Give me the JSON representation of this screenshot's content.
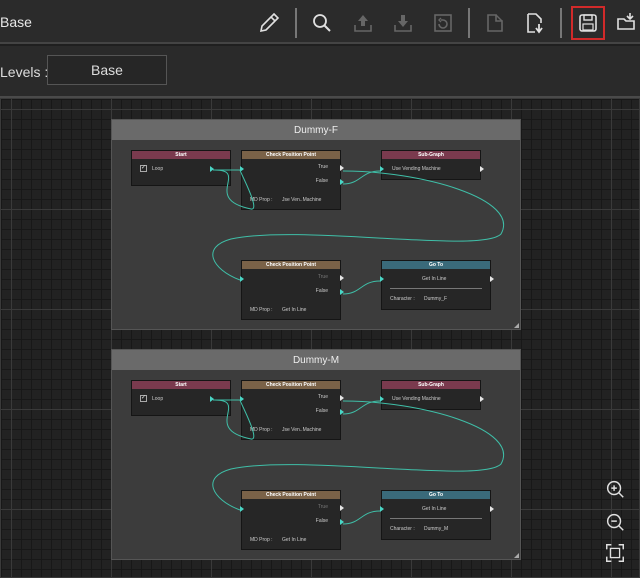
{
  "window": {
    "title": "Base"
  },
  "toolbar": {
    "buttons": [
      {
        "name": "eyedropper-icon",
        "state": "enabled"
      },
      {
        "name": "search-icon",
        "state": "enabled"
      },
      {
        "name": "export-up-icon",
        "state": "disabled"
      },
      {
        "name": "import-down-icon",
        "state": "disabled"
      },
      {
        "name": "refresh-icon",
        "state": "disabled"
      },
      {
        "name": "paste-doc-icon",
        "state": "disabled"
      },
      {
        "name": "document-download-icon",
        "state": "enabled"
      },
      {
        "name": "save-icon",
        "state": "selected"
      },
      {
        "name": "folder-open-icon",
        "state": "enabled"
      }
    ]
  },
  "levels": {
    "label": "Levels :",
    "value": "Base"
  },
  "groups": [
    {
      "title": "Dummy-F",
      "start": {
        "header": "Start",
        "loop_label": "Loop",
        "loop_checked": true
      },
      "check1": {
        "header": "Check Position Point",
        "true_label": "True",
        "false_label": "False",
        "prop_label": "MD Prop :",
        "prop_value": "Jse Ven..Machine"
      },
      "subgraph": {
        "header": "Sub-Graph",
        "value": "Use Vending Machine"
      },
      "check2": {
        "header": "Check Position Point",
        "true_label": "True",
        "false_label": "False",
        "prop_label": "MD Prop :",
        "prop_value": "Get In Line"
      },
      "goto": {
        "header": "Go To",
        "value": "Get In Line",
        "char_label": "Character :",
        "char_value": "Dummy_F"
      }
    },
    {
      "title": "Dummy-M",
      "start": {
        "header": "Start",
        "loop_label": "Loop",
        "loop_checked": true
      },
      "check1": {
        "header": "Check Position Point",
        "true_label": "True",
        "false_label": "False",
        "prop_label": "MD Prop :",
        "prop_value": "Jse Ven..Machine"
      },
      "subgraph": {
        "header": "Sub-Graph",
        "value": "Use Vending Machine"
      },
      "check2": {
        "header": "Check Position Point",
        "true_label": "True",
        "false_label": "False",
        "prop_label": "MD Prop :",
        "prop_value": "Get In Line"
      },
      "goto": {
        "header": "Go To",
        "value": "Get In Line",
        "char_label": "Character :",
        "char_value": "Dummy_M"
      }
    }
  ],
  "zoom_controls": [
    {
      "name": "zoom-in-icon"
    },
    {
      "name": "zoom-out-icon"
    },
    {
      "name": "fit-view-icon"
    }
  ],
  "colors": {
    "accent_wire": "#4ad6c6",
    "selected_outline": "#d12a2a",
    "start_header": "#7a3a4e",
    "check_header": "#7a6248",
    "goto_header": "#3a6a7a"
  }
}
